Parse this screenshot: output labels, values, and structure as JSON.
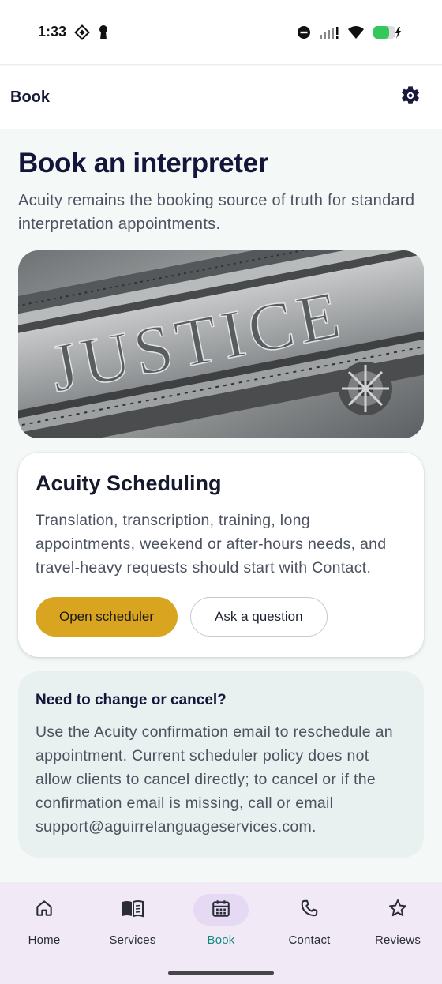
{
  "status_bar": {
    "time": "1:33"
  },
  "app_bar": {
    "title": "Book"
  },
  "page": {
    "title": "Book an interpreter",
    "subtitle": "Acuity remains the booking source of truth for standard interpretation appointments."
  },
  "hero_image": {
    "carved_text": "JUSTICE"
  },
  "scheduling_card": {
    "title": "Acuity Scheduling",
    "body": "Translation, transcription, training, long appointments, weekend or after-hours needs, and travel-heavy requests should start with Contact.",
    "primary_button": "Open scheduler",
    "secondary_button": "Ask a question"
  },
  "change_card": {
    "title": "Need to change or cancel?",
    "body": "Use the Acuity confirmation email to reschedule an appointment. Current scheduler policy does not allow clients to cancel directly; to cancel or if the confirmation email is missing, call or email support@aguirrelanguageservices.com."
  },
  "bottom_nav": {
    "items": [
      {
        "label": "Home",
        "icon": "home-icon",
        "active": false
      },
      {
        "label": "Services",
        "icon": "book-icon",
        "active": false
      },
      {
        "label": "Book",
        "icon": "calendar-icon",
        "active": true
      },
      {
        "label": "Contact",
        "icon": "phone-icon",
        "active": false
      },
      {
        "label": "Reviews",
        "icon": "star-icon",
        "active": false
      }
    ]
  },
  "colors": {
    "accent": "#d9a521",
    "active_nav": "#12897c",
    "title": "#13163b"
  }
}
